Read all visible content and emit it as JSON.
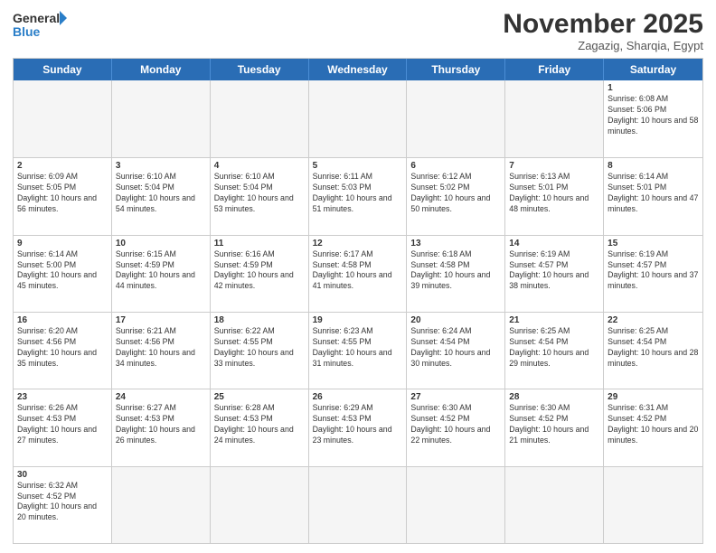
{
  "header": {
    "logo_general": "General",
    "logo_blue": "Blue",
    "month_title": "November 2025",
    "subtitle": "Zagazig, Sharqia, Egypt"
  },
  "weekdays": [
    "Sunday",
    "Monday",
    "Tuesday",
    "Wednesday",
    "Thursday",
    "Friday",
    "Saturday"
  ],
  "rows": [
    [
      {
        "day": "",
        "text": ""
      },
      {
        "day": "",
        "text": ""
      },
      {
        "day": "",
        "text": ""
      },
      {
        "day": "",
        "text": ""
      },
      {
        "day": "",
        "text": ""
      },
      {
        "day": "",
        "text": ""
      },
      {
        "day": "1",
        "text": "Sunrise: 6:08 AM\nSunset: 5:06 PM\nDaylight: 10 hours and 58 minutes."
      }
    ],
    [
      {
        "day": "2",
        "text": "Sunrise: 6:09 AM\nSunset: 5:05 PM\nDaylight: 10 hours and 56 minutes."
      },
      {
        "day": "3",
        "text": "Sunrise: 6:10 AM\nSunset: 5:04 PM\nDaylight: 10 hours and 54 minutes."
      },
      {
        "day": "4",
        "text": "Sunrise: 6:10 AM\nSunset: 5:04 PM\nDaylight: 10 hours and 53 minutes."
      },
      {
        "day": "5",
        "text": "Sunrise: 6:11 AM\nSunset: 5:03 PM\nDaylight: 10 hours and 51 minutes."
      },
      {
        "day": "6",
        "text": "Sunrise: 6:12 AM\nSunset: 5:02 PM\nDaylight: 10 hours and 50 minutes."
      },
      {
        "day": "7",
        "text": "Sunrise: 6:13 AM\nSunset: 5:01 PM\nDaylight: 10 hours and 48 minutes."
      },
      {
        "day": "8",
        "text": "Sunrise: 6:14 AM\nSunset: 5:01 PM\nDaylight: 10 hours and 47 minutes."
      }
    ],
    [
      {
        "day": "9",
        "text": "Sunrise: 6:14 AM\nSunset: 5:00 PM\nDaylight: 10 hours and 45 minutes."
      },
      {
        "day": "10",
        "text": "Sunrise: 6:15 AM\nSunset: 4:59 PM\nDaylight: 10 hours and 44 minutes."
      },
      {
        "day": "11",
        "text": "Sunrise: 6:16 AM\nSunset: 4:59 PM\nDaylight: 10 hours and 42 minutes."
      },
      {
        "day": "12",
        "text": "Sunrise: 6:17 AM\nSunset: 4:58 PM\nDaylight: 10 hours and 41 minutes."
      },
      {
        "day": "13",
        "text": "Sunrise: 6:18 AM\nSunset: 4:58 PM\nDaylight: 10 hours and 39 minutes."
      },
      {
        "day": "14",
        "text": "Sunrise: 6:19 AM\nSunset: 4:57 PM\nDaylight: 10 hours and 38 minutes."
      },
      {
        "day": "15",
        "text": "Sunrise: 6:19 AM\nSunset: 4:57 PM\nDaylight: 10 hours and 37 minutes."
      }
    ],
    [
      {
        "day": "16",
        "text": "Sunrise: 6:20 AM\nSunset: 4:56 PM\nDaylight: 10 hours and 35 minutes."
      },
      {
        "day": "17",
        "text": "Sunrise: 6:21 AM\nSunset: 4:56 PM\nDaylight: 10 hours and 34 minutes."
      },
      {
        "day": "18",
        "text": "Sunrise: 6:22 AM\nSunset: 4:55 PM\nDaylight: 10 hours and 33 minutes."
      },
      {
        "day": "19",
        "text": "Sunrise: 6:23 AM\nSunset: 4:55 PM\nDaylight: 10 hours and 31 minutes."
      },
      {
        "day": "20",
        "text": "Sunrise: 6:24 AM\nSunset: 4:54 PM\nDaylight: 10 hours and 30 minutes."
      },
      {
        "day": "21",
        "text": "Sunrise: 6:25 AM\nSunset: 4:54 PM\nDaylight: 10 hours and 29 minutes."
      },
      {
        "day": "22",
        "text": "Sunrise: 6:25 AM\nSunset: 4:54 PM\nDaylight: 10 hours and 28 minutes."
      }
    ],
    [
      {
        "day": "23",
        "text": "Sunrise: 6:26 AM\nSunset: 4:53 PM\nDaylight: 10 hours and 27 minutes."
      },
      {
        "day": "24",
        "text": "Sunrise: 6:27 AM\nSunset: 4:53 PM\nDaylight: 10 hours and 26 minutes."
      },
      {
        "day": "25",
        "text": "Sunrise: 6:28 AM\nSunset: 4:53 PM\nDaylight: 10 hours and 24 minutes."
      },
      {
        "day": "26",
        "text": "Sunrise: 6:29 AM\nSunset: 4:53 PM\nDaylight: 10 hours and 23 minutes."
      },
      {
        "day": "27",
        "text": "Sunrise: 6:30 AM\nSunset: 4:52 PM\nDaylight: 10 hours and 22 minutes."
      },
      {
        "day": "28",
        "text": "Sunrise: 6:30 AM\nSunset: 4:52 PM\nDaylight: 10 hours and 21 minutes."
      },
      {
        "day": "29",
        "text": "Sunrise: 6:31 AM\nSunset: 4:52 PM\nDaylight: 10 hours and 20 minutes."
      }
    ],
    [
      {
        "day": "30",
        "text": "Sunrise: 6:32 AM\nSunset: 4:52 PM\nDaylight: 10 hours and 20 minutes."
      },
      {
        "day": "",
        "text": ""
      },
      {
        "day": "",
        "text": ""
      },
      {
        "day": "",
        "text": ""
      },
      {
        "day": "",
        "text": ""
      },
      {
        "day": "",
        "text": ""
      },
      {
        "day": "",
        "text": ""
      }
    ]
  ]
}
